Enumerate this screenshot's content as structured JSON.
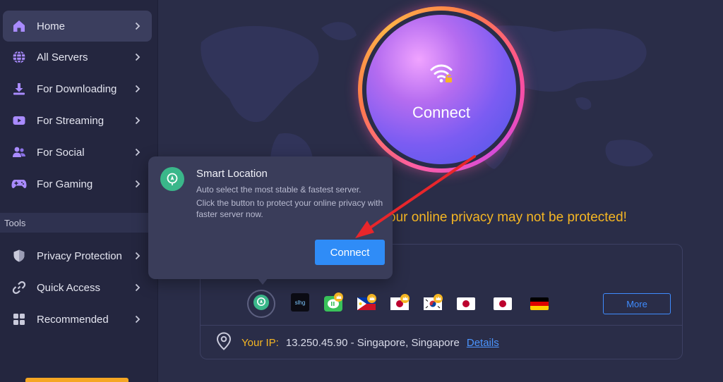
{
  "sidebar": {
    "items": [
      {
        "label": "Home",
        "icon": "home-icon",
        "active": true
      },
      {
        "label": "All Servers",
        "icon": "globe-icon"
      },
      {
        "label": "For Downloading",
        "icon": "download-icon"
      },
      {
        "label": "For Streaming",
        "icon": "play-icon"
      },
      {
        "label": "For Social",
        "icon": "users-icon"
      },
      {
        "label": "For Gaming",
        "icon": "gamepad-icon"
      }
    ],
    "tools_heading": "Tools",
    "tools": [
      {
        "label": "Privacy Protection",
        "icon": "shield-icon"
      },
      {
        "label": "Quick Access",
        "icon": "link-icon"
      },
      {
        "label": "Recommended",
        "icon": "grid-icon"
      }
    ],
    "accent_color": "#8b6cf6"
  },
  "main": {
    "connect_label": "Connect",
    "warning": "our online privacy may not be protected!",
    "servers": [
      {
        "name": "smart-location",
        "icon": "smart-location-icon"
      },
      {
        "name": "streaming",
        "text": "slhg"
      },
      {
        "name": "vietnam-line",
        "icon": "line-app-icon",
        "crown": true
      },
      {
        "name": "philippines",
        "flag": "philippines",
        "crown": true
      },
      {
        "name": "japan-1",
        "flag": "japan",
        "crown": true
      },
      {
        "name": "korea",
        "flag": "south-korea",
        "crown": true
      },
      {
        "name": "japan-2",
        "flag": "japan"
      },
      {
        "name": "japan-3",
        "flag": "japan"
      },
      {
        "name": "germany",
        "flag": "germany"
      }
    ],
    "more_label": "More",
    "ip": {
      "label": "Your IP:",
      "value": "13.250.45.90 - Singapore, Singapore",
      "details_label": "Details"
    }
  },
  "popover": {
    "title": "Smart Location",
    "line1": "Auto select the most stable & fastest server.",
    "line2": "Click the button to protect your online privacy with faster server now.",
    "connect_label": "Connect"
  },
  "colors": {
    "warning": "#f5b623",
    "primary_button": "#2f8cf7",
    "link": "#4b95ff"
  }
}
